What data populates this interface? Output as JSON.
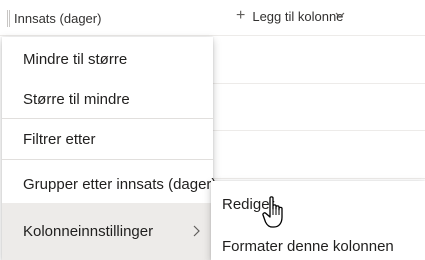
{
  "header": {
    "column_title": "Innsats (dager)",
    "add_column_label": "Legg til kolonne"
  },
  "menu": {
    "items": [
      {
        "label": "Mindre til større"
      },
      {
        "label": "Større til mindre"
      },
      {
        "label": "Filtrer etter"
      },
      {
        "label": "Grupper etter innsats (dager)"
      },
      {
        "label": "Kolonneinnstillinger"
      }
    ]
  },
  "submenu": {
    "items": [
      {
        "label": "Rediger"
      },
      {
        "label": "Formater denne kolonnen"
      }
    ]
  },
  "icons": {
    "add": "plus-icon",
    "add_dropdown": "chevron-down-icon",
    "submenu": "chevron-right-icon",
    "cursor": "hand-pointer-icon"
  },
  "colors": {
    "hover_background": "#edebe9",
    "text": "#201f1e",
    "divider": "#e1dfdd"
  }
}
